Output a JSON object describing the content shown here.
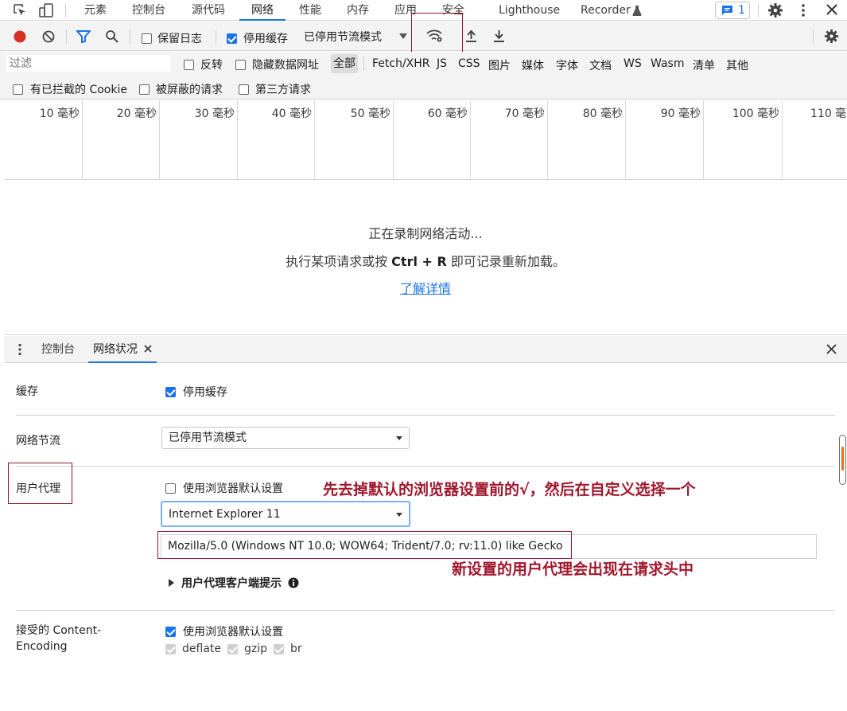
{
  "tabs": {
    "elements": "元素",
    "console": "控制台",
    "sources": "源代码",
    "network": "网络",
    "performance": "性能",
    "memory": "内存",
    "application": "应用",
    "security": "安全",
    "lighthouse": "Lighthouse",
    "recorder": "Recorder",
    "issues_count": "1"
  },
  "toolbar": {
    "preserve_log": "保留日志",
    "disable_cache": "停用缓存",
    "throttle": "已停用节流模式"
  },
  "filter": {
    "placeholder": "过滤",
    "invert": "反转",
    "hide_data_urls": "隐藏数据网址",
    "types": [
      "全部",
      "Fetch/XHR",
      "JS",
      "CSS",
      "图片",
      "媒体",
      "字体",
      "文档",
      "WS",
      "Wasm",
      "清单",
      "其他"
    ],
    "blocked_cookies": "有已拦截的 Cookie",
    "blocked_requests": "被屏蔽的请求",
    "third_party": "第三方请求"
  },
  "timeline": {
    "ticks": [
      "10 毫秒",
      "20 毫秒",
      "30 毫秒",
      "40 毫秒",
      "50 毫秒",
      "60 毫秒",
      "70 毫秒",
      "80 毫秒",
      "90 毫秒",
      "100 毫秒",
      "110 毫"
    ]
  },
  "recording": {
    "line1": "正在录制网络活动...",
    "line2_prefix": "执行某项请求或按 ",
    "shortcut": "Ctrl + R",
    "line2_suffix": " 即可记录重新加载。",
    "learn_more": "了解详情"
  },
  "drawer": {
    "tab_console": "控制台",
    "tab_network_conditions": "网络状况"
  },
  "conditions": {
    "cache_label": "缓存",
    "cache_checkbox": "停用缓存",
    "throttling_label": "网络节流",
    "throttling_value": "已停用节流模式",
    "ua_label": "用户代理",
    "ua_default_checkbox": "使用浏览器默认设置",
    "ua_select_value": "Internet Explorer 11",
    "ua_string": "Mozilla/5.0 (Windows NT 10.0; WOW64; Trident/7.0; rv:11.0) like Gecko",
    "ua_client_hints": "用户代理客户端提示",
    "encoding_label_1": "接受的 Content-",
    "encoding_label_2": "Encoding",
    "encoding_default_checkbox": "使用浏览器默认设置",
    "encodings": [
      "deflate",
      "gzip",
      "br"
    ]
  },
  "annotations": {
    "note1": "先去掉默认的浏览器设置前的√，然后在自定义选择一个",
    "note2": "新设置的用户代理会出现在请求头中"
  },
  "colors": {
    "accent": "#1a73e8",
    "record_red": "#d93025",
    "annotation": "#a0182e"
  }
}
